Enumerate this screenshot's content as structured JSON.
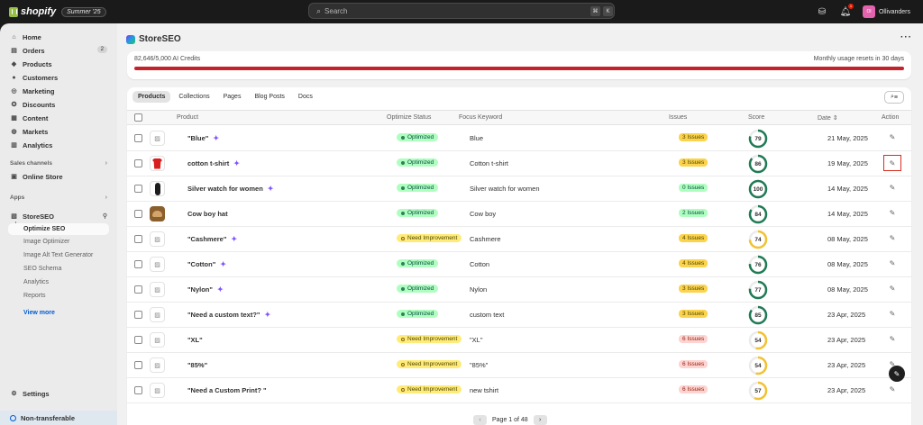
{
  "topbar": {
    "brand": "shopify",
    "edition": "Summer '25",
    "search_placeholder": "Search",
    "kbd1": "⌘",
    "kbd2": "K",
    "store_name": "Ollivanders",
    "avatar": "Ol",
    "bell_count": "1"
  },
  "sidebar": {
    "items": [
      {
        "label": "Home",
        "icon": "home-icon"
      },
      {
        "label": "Orders",
        "icon": "orders-icon",
        "badge": "2"
      },
      {
        "label": "Products",
        "icon": "tag-icon"
      },
      {
        "label": "Customers",
        "icon": "person-icon"
      },
      {
        "label": "Marketing",
        "icon": "target-icon"
      },
      {
        "label": "Discounts",
        "icon": "discount-icon"
      },
      {
        "label": "Content",
        "icon": "content-icon"
      },
      {
        "label": "Markets",
        "icon": "globe-icon"
      },
      {
        "label": "Analytics",
        "icon": "chart-icon"
      }
    ],
    "sales_channels_label": "Sales channels",
    "online_store": "Online Store",
    "apps_label": "Apps",
    "app_name": "StoreSEO",
    "sub_items": [
      "Optimize SEO",
      "Image Optimizer",
      "Image Alt Text Generator",
      "SEO Schema",
      "Analytics",
      "Reports"
    ],
    "view_more": "View more",
    "settings": "Settings",
    "non_transferable": "Non-transferable"
  },
  "main": {
    "app_title": "StoreSEO",
    "credits_used": "82,646/5,000 AI Credits",
    "credits_reset": "Monthly usage resets in 30 days",
    "tabs": [
      "Products",
      "Collections",
      "Pages",
      "Blog Posts",
      "Docs"
    ],
    "columns": {
      "product": "Product",
      "status": "Optimize Status",
      "keyword": "Focus Keyword",
      "issues": "Issues",
      "score": "Score",
      "date": "Date",
      "action": "Action"
    },
    "rows": [
      {
        "name": "\"Blue\"",
        "thumb": "placeholder",
        "status": "Optimized",
        "keyword": "Blue",
        "issues": "3 Issues",
        "issues_tone": "yellow",
        "score": "79",
        "date": "21 May, 2025"
      },
      {
        "name": "cotton t-shirt",
        "thumb": "tshirt",
        "status": "Optimized",
        "keyword": "Cotton t-shirt",
        "issues": "3 Issues",
        "issues_tone": "yellow",
        "score": "86",
        "date": "19 May, 2025"
      },
      {
        "name": "Silver watch for women",
        "thumb": "watch",
        "status": "Optimized",
        "keyword": "Silver watch for women",
        "issues": "0 Issues",
        "issues_tone": "green",
        "score": "100",
        "date": "14 May, 2025"
      },
      {
        "name": "Cow boy hat",
        "thumb": "hat",
        "status": "Optimized",
        "keyword": "Cow boy",
        "issues": "2 Issues",
        "issues_tone": "green",
        "score": "84",
        "date": "14 May, 2025"
      },
      {
        "name": "\"Cashmere\"",
        "thumb": "placeholder",
        "status": "Need Improvement",
        "keyword": "Cashmere",
        "issues": "4 Issues",
        "issues_tone": "yellow",
        "score": "74",
        "date": "08 May, 2025"
      },
      {
        "name": "\"Cotton\"",
        "thumb": "placeholder",
        "status": "Optimized",
        "keyword": "Cotton",
        "issues": "4 Issues",
        "issues_tone": "yellow",
        "score": "76",
        "date": "08 May, 2025"
      },
      {
        "name": "\"Nylon\"",
        "thumb": "placeholder",
        "status": "Optimized",
        "keyword": "Nylon",
        "issues": "3 Issues",
        "issues_tone": "yellow",
        "score": "77",
        "date": "08 May, 2025"
      },
      {
        "name": "\"Need a custom text?\"",
        "thumb": "placeholder",
        "status": "Optimized",
        "keyword": "custom text",
        "issues": "3 Issues",
        "issues_tone": "yellow",
        "score": "85",
        "date": "23 Apr, 2025"
      },
      {
        "name": "\"XL\"",
        "thumb": "placeholder",
        "status": "Need Improvement",
        "keyword": "\"XL\"",
        "issues": "6 Issues",
        "issues_tone": "red",
        "score": "54",
        "date": "23 Apr, 2025"
      },
      {
        "name": "\"85%\"",
        "thumb": "placeholder",
        "status": "Need Improvement",
        "keyword": "\"85%\"",
        "issues": "6 Issues",
        "issues_tone": "red",
        "score": "54",
        "date": "23 Apr, 2025"
      },
      {
        "name": "\"Need a Custom Print? \"",
        "thumb": "placeholder",
        "status": "Need Improvement",
        "keyword": "new tshirt",
        "issues": "6 Issues",
        "issues_tone": "red",
        "score": "57",
        "date": "23 Apr, 2025"
      }
    ],
    "pager": "Page 1 of 48"
  },
  "colors": {
    "optimized_ring": "#1f7a55",
    "need_ring": "#f2c232",
    "credits_bar": "#c4232b",
    "link": "#005bd3"
  }
}
